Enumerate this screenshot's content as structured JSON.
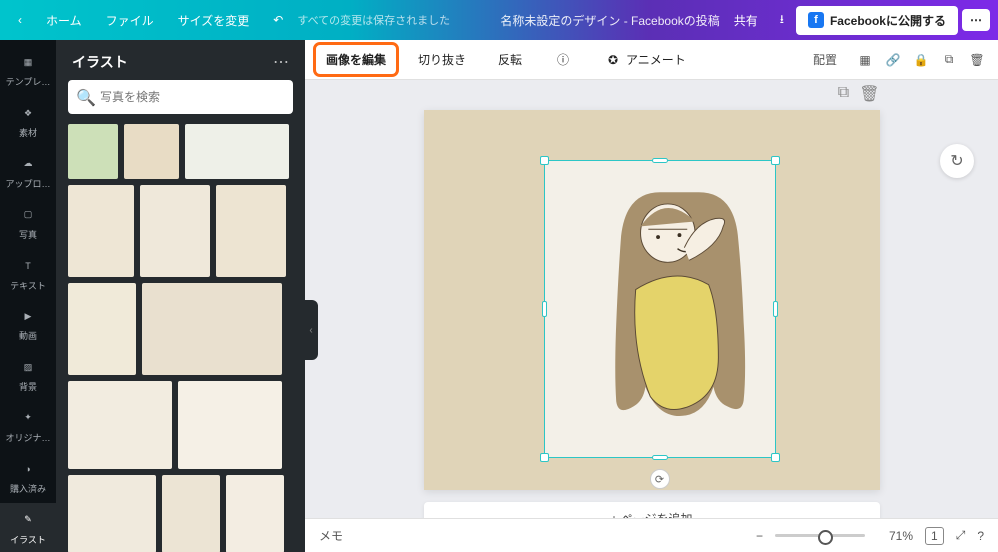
{
  "topbar": {
    "home": "ホーム",
    "file": "ファイル",
    "resize": "サイズを変更",
    "saved": "すべての変更は保存されました",
    "title": "名称未設定のデザイン - Facebookの投稿",
    "share": "共有",
    "publish": "Facebookに公開する"
  },
  "rail": {
    "items": [
      {
        "k": "templates",
        "label": "テンプレ…"
      },
      {
        "k": "elements",
        "label": "素材"
      },
      {
        "k": "uploads",
        "label": "アップロ…"
      },
      {
        "k": "photos",
        "label": "写真"
      },
      {
        "k": "text",
        "label": "テキスト"
      },
      {
        "k": "videos",
        "label": "動画"
      },
      {
        "k": "background",
        "label": "背景"
      },
      {
        "k": "original",
        "label": "オリジナ…"
      },
      {
        "k": "purchased",
        "label": "購入済み"
      },
      {
        "k": "illust",
        "label": "イラスト"
      }
    ]
  },
  "panel": {
    "title": "イラスト",
    "search_placeholder": "写真を検索"
  },
  "toolbar": {
    "edit_image": "画像を編集",
    "crop": "切り抜き",
    "flip": "反転",
    "animate": "アニメート",
    "position": "配置"
  },
  "canvas": {
    "add_page": "+ ページを追加"
  },
  "bottombar": {
    "memo": "メモ",
    "zoom": "71%",
    "page": "1"
  }
}
